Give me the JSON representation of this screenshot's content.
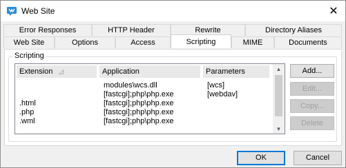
{
  "window": {
    "title": "Web Site",
    "close_glyph": "✕",
    "icon": "website-icon"
  },
  "tabs": {
    "top_row": [
      {
        "label": "Error Responses"
      },
      {
        "label": "HTTP Header"
      },
      {
        "label": "Rewrite"
      },
      {
        "label": "Directory Aliases"
      }
    ],
    "bottom_row": [
      {
        "label": "Web Site"
      },
      {
        "label": "Options"
      },
      {
        "label": "Access"
      },
      {
        "label": "Scripting"
      },
      {
        "label": "MIME"
      },
      {
        "label": "Documents"
      }
    ],
    "selected": "Scripting"
  },
  "scripting": {
    "group_label": "Scripting",
    "columns": {
      "extension": "Extension",
      "application": "Application",
      "parameters": "Parameters"
    },
    "sort_glyph": "◿",
    "rows": [
      {
        "extension": "",
        "application": "modules\\wcs.dll",
        "parameters": "[wcs]"
      },
      {
        "extension": "",
        "application": "[fastcgi];php\\php.exe",
        "parameters": "[webdav]"
      },
      {
        "extension": ".html",
        "application": "[fastcgi];php\\php.exe",
        "parameters": ""
      },
      {
        "extension": ".php",
        "application": "[fastcgi];php\\php.exe",
        "parameters": ""
      },
      {
        "extension": ".wml",
        "application": "[fastcgi];php\\php.exe",
        "parameters": ""
      }
    ],
    "scroll_up": "▲",
    "scroll_down": "▼",
    "buttons": {
      "add": "Add...",
      "edit": "Edit...",
      "copy": "Copy...",
      "delete": "Delete"
    }
  },
  "dialog_buttons": {
    "ok": "OK",
    "cancel": "Cancel"
  }
}
